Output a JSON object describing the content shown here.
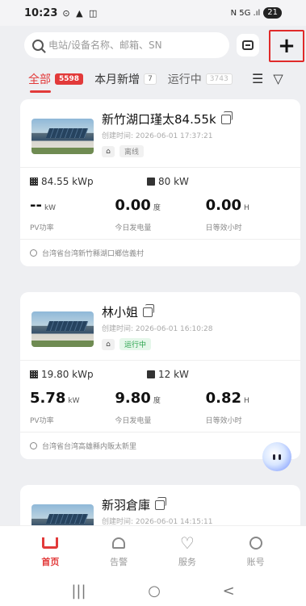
{
  "status": {
    "time": "10:23",
    "left_icons": "⊙ ▲ ◫",
    "signal": "N 5G .ıl",
    "battery": "21"
  },
  "search": {
    "placeholder": "电站/设备名称、邮箱、SN"
  },
  "tabs": [
    {
      "label": "全部",
      "count": "5598"
    },
    {
      "label": "本月新增",
      "count": "7"
    },
    {
      "label": "运行中",
      "count": "3743"
    }
  ],
  "plants": [
    {
      "name": "新竹湖口瑾太84.55k",
      "created": "创建时间: 2026-06-01 17:37:21",
      "status": "离线",
      "capacity": "84.55 kWp",
      "inverter": "80 kW",
      "pv_power": "--",
      "pv_power_unit": "kW",
      "today_energy": "0.00",
      "today_energy_unit": "度",
      "equiv_hours": "0.00",
      "equiv_hours_unit": "H",
      "pv_label": "PV功率",
      "energy_label": "今日发电量",
      "hours_label": "日等效小时",
      "address": "台湾省台湾新竹縣湖口鄉信義村"
    },
    {
      "name": "林小姐",
      "created": "创建时间: 2026-06-01 16:10:28",
      "status": "运行中",
      "capacity": "19.80 kWp",
      "inverter": "12 kW",
      "pv_power": "5.78",
      "pv_power_unit": "kW",
      "today_energy": "9.80",
      "today_energy_unit": "度",
      "equiv_hours": "0.82",
      "equiv_hours_unit": "H",
      "pv_label": "PV功率",
      "energy_label": "今日发电量",
      "hours_label": "日等效小时",
      "address": "台湾省台湾高雄縣内販太新里"
    },
    {
      "name": "新羽倉庫",
      "created": "创建时间: 2026-06-01 14:15:11"
    }
  ],
  "tabbar": [
    {
      "label": "首页"
    },
    {
      "label": "告警"
    },
    {
      "label": "服务"
    },
    {
      "label": "账号"
    }
  ],
  "navbar": {
    "recent": "|||",
    "home": "○",
    "back": "<"
  },
  "colors": {
    "accent": "#e23a3a",
    "running": "#27a24b"
  }
}
